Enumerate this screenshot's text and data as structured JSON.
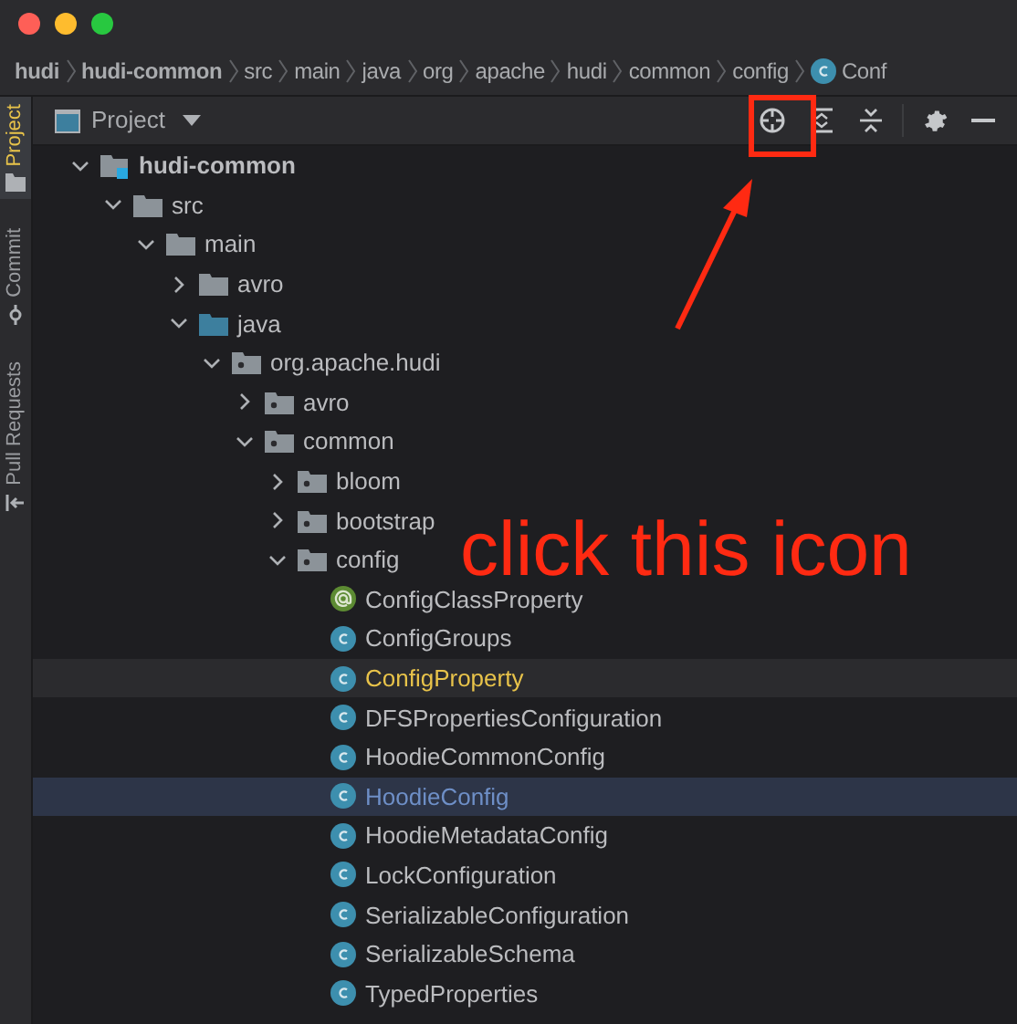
{
  "breadcrumb": [
    {
      "label": "hudi",
      "kind": "project"
    },
    {
      "label": "hudi-common",
      "kind": "module"
    },
    {
      "label": "src",
      "kind": "dir"
    },
    {
      "label": "main",
      "kind": "dir"
    },
    {
      "label": "java",
      "kind": "dir"
    },
    {
      "label": "org",
      "kind": "dir"
    },
    {
      "label": "apache",
      "kind": "dir"
    },
    {
      "label": "hudi",
      "kind": "dir"
    },
    {
      "label": "common",
      "kind": "dir"
    },
    {
      "label": "config",
      "kind": "dir"
    },
    {
      "label": "Conf",
      "kind": "class"
    }
  ],
  "side_tabs": [
    {
      "label": "Project",
      "selected": true
    },
    {
      "label": "Commit",
      "selected": false
    },
    {
      "label": "Pull Requests",
      "selected": false
    }
  ],
  "panel": {
    "title": "Project"
  },
  "tree": [
    {
      "label": "hudi-common",
      "kind": "module",
      "expanded": true,
      "selected": false,
      "highlighted": false,
      "children": [
        {
          "label": "src",
          "kind": "folder",
          "expanded": true,
          "selected": false,
          "highlighted": false,
          "children": [
            {
              "label": "main",
              "kind": "folder",
              "expanded": true,
              "selected": false,
              "highlighted": false,
              "children": [
                {
                  "label": "avro",
                  "kind": "folder",
                  "expanded": false,
                  "selected": false,
                  "highlighted": false
                },
                {
                  "label": "java",
                  "kind": "source",
                  "expanded": true,
                  "selected": false,
                  "highlighted": false,
                  "children": [
                    {
                      "label": "org.apache.hudi",
                      "kind": "package",
                      "expanded": true,
                      "selected": false,
                      "highlighted": false,
                      "children": [
                        {
                          "label": "avro",
                          "kind": "package",
                          "expanded": false,
                          "selected": false,
                          "highlighted": false
                        },
                        {
                          "label": "common",
                          "kind": "package",
                          "expanded": true,
                          "selected": false,
                          "highlighted": false,
                          "children": [
                            {
                              "label": "bloom",
                              "kind": "package",
                              "expanded": false,
                              "selected": false,
                              "highlighted": false
                            },
                            {
                              "label": "bootstrap",
                              "kind": "package",
                              "expanded": false,
                              "selected": false,
                              "highlighted": false
                            },
                            {
                              "label": "config",
                              "kind": "package",
                              "expanded": true,
                              "selected": false,
                              "highlighted": false,
                              "children": [
                                {
                                  "label": "ConfigClassProperty",
                                  "kind": "annotation",
                                  "selected": false,
                                  "highlighted": false
                                },
                                {
                                  "label": "ConfigGroups",
                                  "kind": "class",
                                  "selected": false,
                                  "highlighted": false
                                },
                                {
                                  "label": "ConfigProperty",
                                  "kind": "class",
                                  "selected": false,
                                  "highlighted": true
                                },
                                {
                                  "label": "DFSPropertiesConfiguration",
                                  "kind": "class",
                                  "selected": false,
                                  "highlighted": false
                                },
                                {
                                  "label": "HoodieCommonConfig",
                                  "kind": "class",
                                  "selected": false,
                                  "highlighted": false
                                },
                                {
                                  "label": "HoodieConfig",
                                  "kind": "class",
                                  "selected": true,
                                  "highlighted": false
                                },
                                {
                                  "label": "HoodieMetadataConfig",
                                  "kind": "class",
                                  "selected": false,
                                  "highlighted": false
                                },
                                {
                                  "label": "LockConfiguration",
                                  "kind": "class",
                                  "selected": false,
                                  "highlighted": false
                                },
                                {
                                  "label": "SerializableConfiguration",
                                  "kind": "class",
                                  "selected": false,
                                  "highlighted": false
                                },
                                {
                                  "label": "SerializableSchema",
                                  "kind": "class",
                                  "selected": false,
                                  "highlighted": false
                                },
                                {
                                  "label": "TypedProperties",
                                  "kind": "class",
                                  "selected": false,
                                  "highlighted": false
                                }
                              ]
                            }
                          ]
                        }
                      ]
                    }
                  ]
                }
              ]
            }
          ]
        }
      ]
    }
  ],
  "annotation": {
    "text": "click this icon"
  }
}
